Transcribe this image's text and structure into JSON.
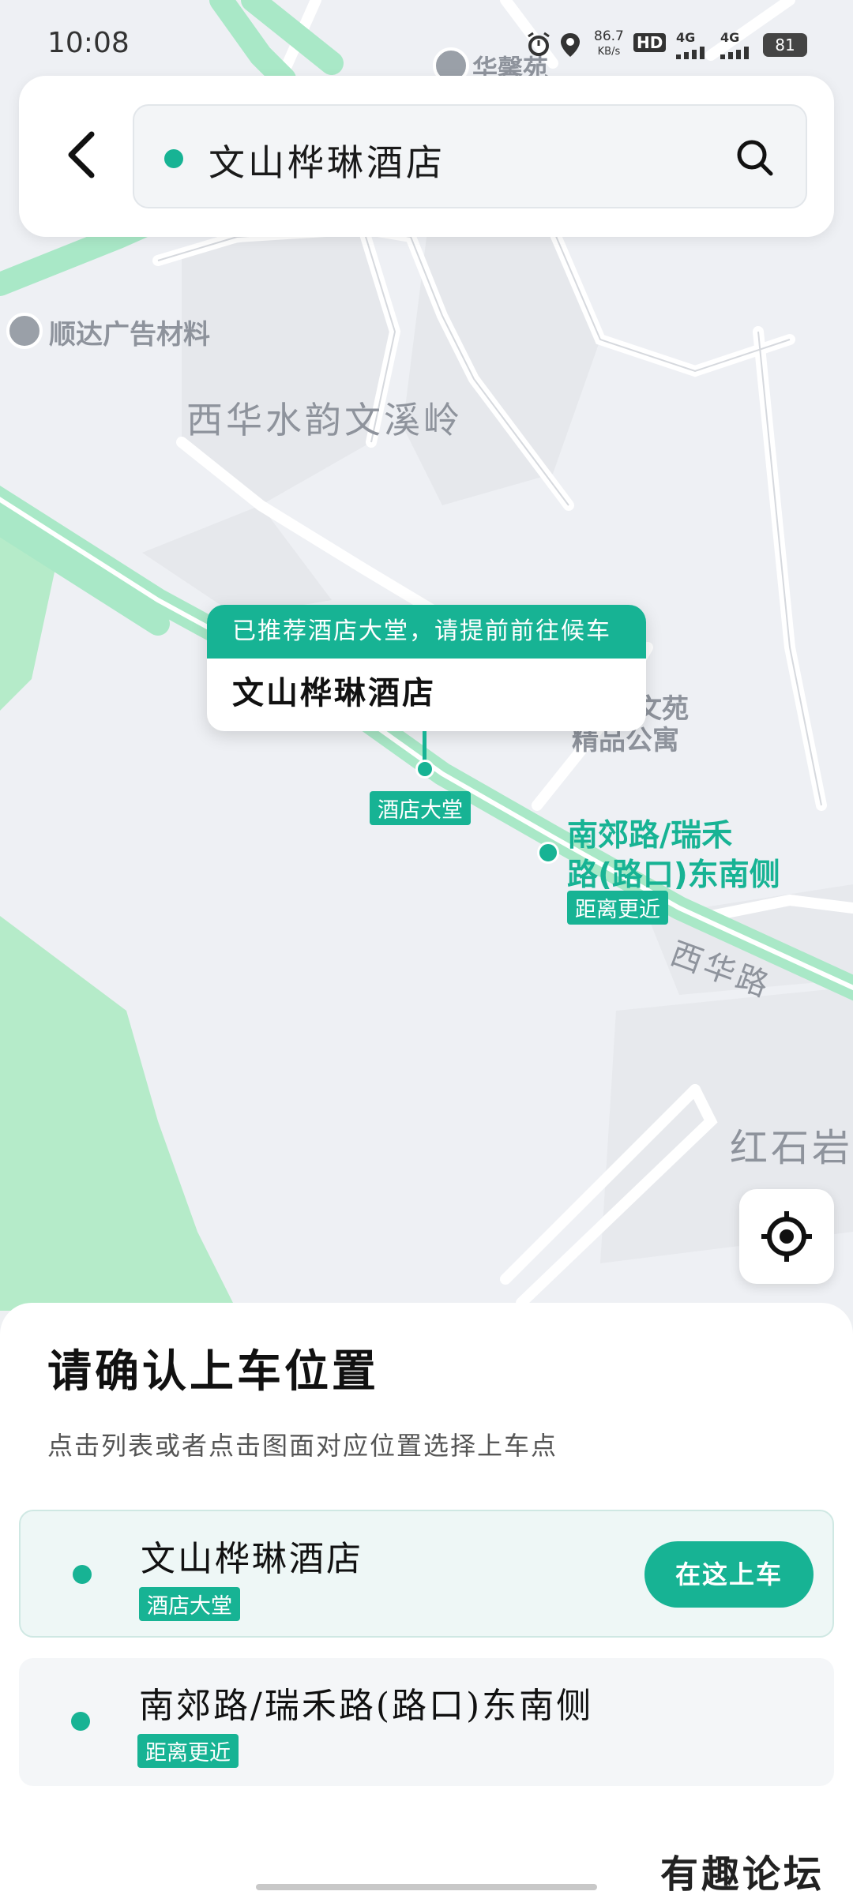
{
  "status_bar": {
    "time": "10:08",
    "net_speed": "86.7",
    "net_unit": "KB/s",
    "hd": "HD",
    "sim1": "4G",
    "sim2": "4G",
    "battery": "81"
  },
  "search": {
    "value": "文山桦琳酒店"
  },
  "map": {
    "labels": {
      "huaxin": "华馨苑",
      "shunda": "顺达广告材料",
      "xihua_community": "西华水韵文溪岭",
      "wenyuan": "文苑",
      "jingpin": "精品公寓",
      "xihua_road": "西华路",
      "hongshiyan": "红石岩"
    },
    "callout": {
      "banner": "已推荐酒店大堂，请提前前往候车",
      "name": "文山桦琳酒店"
    },
    "pin_tag": "酒店大堂",
    "alt_point": {
      "label_line1": "南郊路/瑞禾",
      "label_line2": "路(路口)东南侧",
      "tag": "距离更近"
    }
  },
  "sheet": {
    "title": "请确认上车位置",
    "subtitle": "点击列表或者点击图面对应位置选择上车点",
    "options": [
      {
        "name": "文山桦琳酒店",
        "tag": "酒店大堂",
        "button": "在这上车"
      },
      {
        "name": "南郊路/瑞禾路(路口)东南侧",
        "tag": "距离更近"
      }
    ]
  },
  "watermark": "有趣论坛",
  "colors": {
    "accent": "#17b394",
    "road": "#a9e8c7",
    "green_area": "#b5ebc9",
    "map_bg": "#eef0f4"
  }
}
